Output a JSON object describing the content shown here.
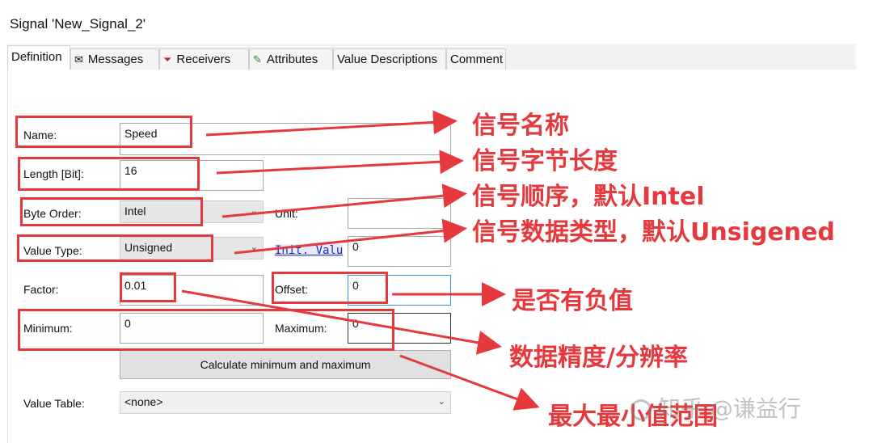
{
  "window": {
    "title": "Signal 'New_Signal_2'"
  },
  "tabs": [
    {
      "label": "Definition",
      "icon": "none",
      "active": true
    },
    {
      "label": "Messages",
      "icon": "envelope-icon"
    },
    {
      "label": "Receivers",
      "icon": "receiver-icon"
    },
    {
      "label": "Attributes",
      "icon": "attribute-pencil-icon"
    },
    {
      "label": "Value Descriptions",
      "icon": "none"
    },
    {
      "label": "Comment",
      "icon": "none"
    }
  ],
  "form": {
    "name_label": "Name:",
    "name_value": "Speed",
    "length_label": "Length [Bit]:",
    "length_value": "16",
    "byte_order_label": "Byte Order:",
    "byte_order_value": "Intel",
    "unit_label": "Unit:",
    "unit_value": "",
    "value_type_label": "Value Type:",
    "value_type_value": "Unsigned",
    "init_value_label": "Init. Valu",
    "init_value": "0",
    "factor_label": "Factor:",
    "factor_value": "0.01",
    "offset_label": "Offset:",
    "offset_value": "0",
    "minimum_label": "Minimum:",
    "minimum_value": "0",
    "maximum_label": "Maximum:",
    "maximum_value": "0",
    "calc_button_label": "Calculate minimum and maximum",
    "value_table_label": "Value Table:",
    "value_table_value": "<none>"
  },
  "annotations": {
    "name": "信号名称",
    "length": "信号字节长度",
    "byte_order": "信号顺序，默认Intel",
    "value_type": "信号数据类型，默认Unsigened",
    "offset": "是否有负值",
    "factor": "数据精度/分辨率",
    "minmax": "最大最小值范围"
  },
  "watermark": {
    "text": "知乎 @谦益行"
  },
  "colors": {
    "annotation": "#e5393d",
    "tab_bar": "#f2f2f2",
    "button": "#e1e1e1"
  }
}
